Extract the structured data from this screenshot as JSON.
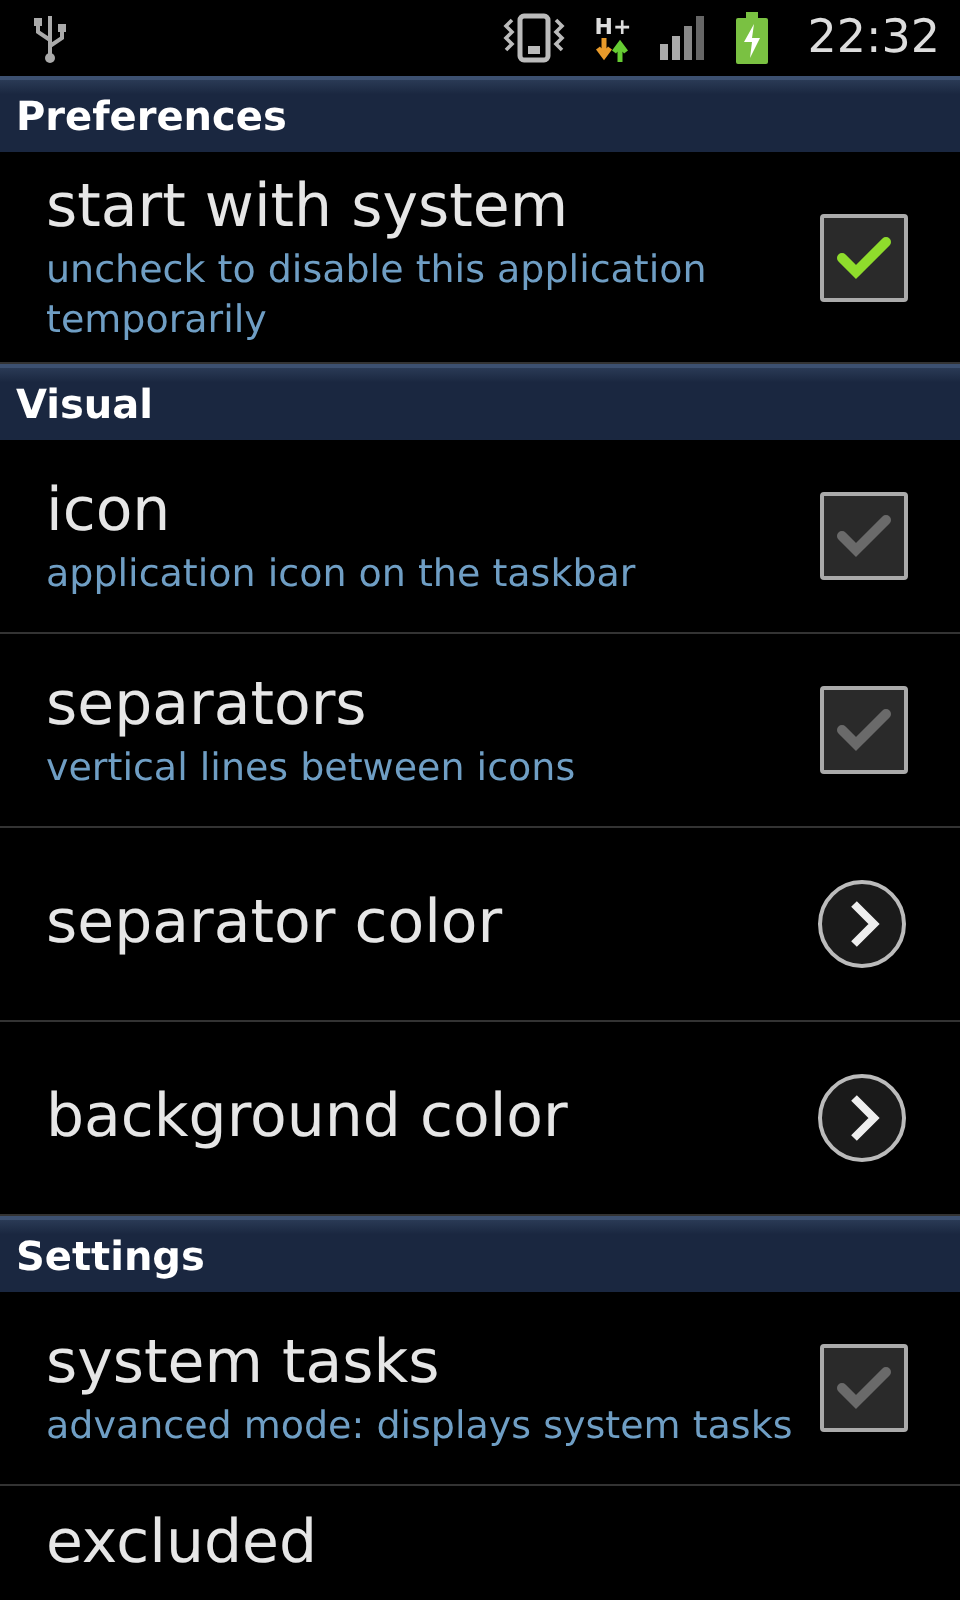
{
  "status_bar": {
    "time": "22:32",
    "network": "H+"
  },
  "sections": [
    {
      "title": "Preferences",
      "items": [
        {
          "kind": "checkbox",
          "title": "start with system",
          "summary": "uncheck to disable this application temporarily",
          "checked": true
        }
      ]
    },
    {
      "title": "Visual",
      "items": [
        {
          "kind": "checkbox",
          "title": "icon",
          "summary": "application icon on the taskbar",
          "checked": false
        },
        {
          "kind": "checkbox",
          "title": "separators",
          "summary": "vertical lines between icons",
          "checked": false
        },
        {
          "kind": "link",
          "title": "separator color"
        },
        {
          "kind": "link",
          "title": "background color"
        }
      ]
    },
    {
      "title": "Settings",
      "items": [
        {
          "kind": "checkbox",
          "title": "system tasks",
          "summary": "advanced mode: displays system tasks",
          "checked": false
        },
        {
          "kind": "link",
          "title": "excluded"
        }
      ]
    }
  ]
}
